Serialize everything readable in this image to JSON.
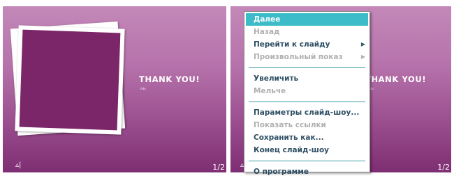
{
  "slides": [
    {
      "title": "THANK YOU!",
      "subtitle": "hdu",
      "counter": "1/2",
      "nav_icon": "▵|"
    },
    {
      "title": "THANK YOU!",
      "subtitle": "hdu",
      "counter": "1/2",
      "nav_icon": "▵|"
    }
  ],
  "context_menu": {
    "next": "Далее",
    "back": "Назад",
    "go_to_slide": "Перейти к слайду",
    "custom_show": "Произвольный показ",
    "zoom_in": "Увеличить",
    "zoom_out": "Мельче",
    "slideshow_settings": "Параметры слайд-шоу...",
    "show_links": "Показать ссылки",
    "save_as": "Сохранить как...",
    "end_slideshow": "Конец слайд-шоу",
    "about": "О программе"
  },
  "colors": {
    "menu_highlight": "#3cbcc8",
    "menu_text": "#2d4e63",
    "photo_fill": "#7b2668"
  }
}
